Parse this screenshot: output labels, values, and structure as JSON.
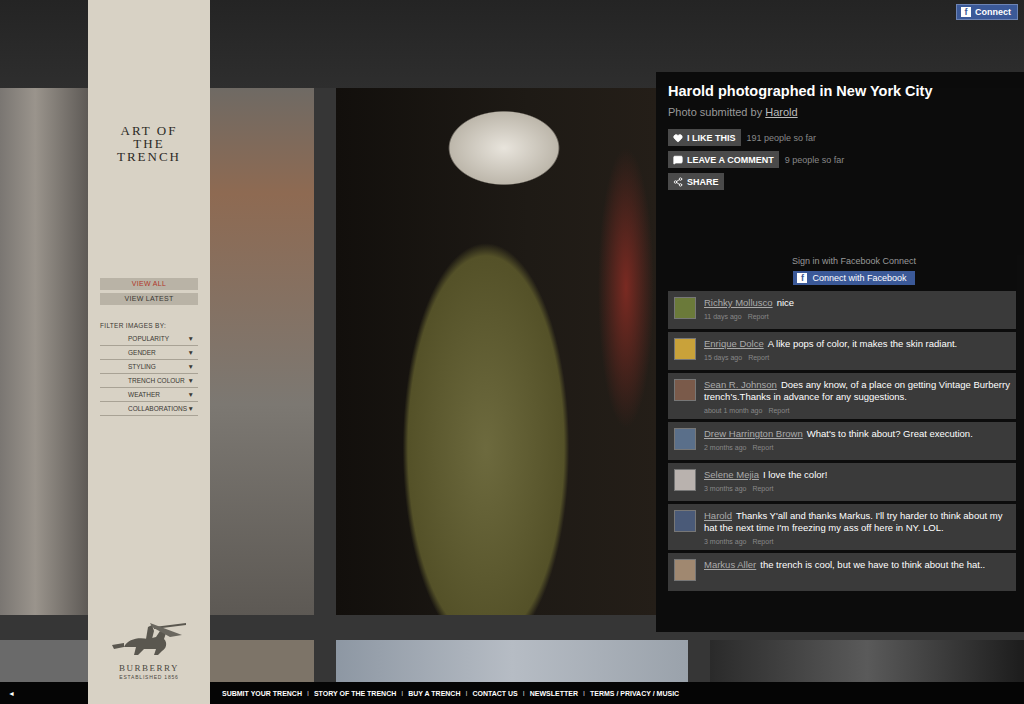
{
  "facebook_connect": {
    "icon": "f",
    "label": "Connect"
  },
  "sidebar": {
    "logo_lines": [
      "ART OF",
      "THE",
      "TRENCH"
    ],
    "nav": [
      {
        "label": "VIEW ALL",
        "selected": true
      },
      {
        "label": "VIEW LATEST",
        "selected": false
      }
    ],
    "filter_heading": "FILTER IMAGES BY:",
    "filters": [
      {
        "label": "POPULARITY",
        "arrow": "▼"
      },
      {
        "label": "GENDER",
        "arrow": "▼"
      },
      {
        "label": "STYLING",
        "arrow": "▼"
      },
      {
        "label": "TRENCH COLOUR",
        "arrow": "▼"
      },
      {
        "label": "WEATHER",
        "arrow": "▼"
      },
      {
        "label": "COLLABORATIONS",
        "arrow": "▼"
      }
    ],
    "brand": "BURBERRY",
    "brand_sub": "ESTABLISHED 1856"
  },
  "detail": {
    "title": "Harold photographed in New York City",
    "submitted_label": "Photo submitted by",
    "submitter": "Harold",
    "actions": [
      {
        "kind": "like",
        "label": "I LIKE THIS",
        "count": "191 people so far"
      },
      {
        "kind": "comment",
        "label": "LEAVE A COMMENT",
        "count": "9 people so far"
      },
      {
        "kind": "share",
        "label": "SHARE",
        "count": ""
      }
    ],
    "signin": "Sign in with Facebook Connect",
    "facebook_button": {
      "icon": "f",
      "label": "Connect with Facebook"
    },
    "report_label": "Report",
    "comments": [
      {
        "name": "Richky Mollusco",
        "text": "nice",
        "time": "11 days ago",
        "color": "#6b7a3a"
      },
      {
        "name": "Enrique Dolce",
        "text": "A like pops of color, it makes the skin radiant.",
        "time": "15 days ago",
        "color": "#c9a23a"
      },
      {
        "name": "Sean R. Johnson",
        "text": "Does any know, of a place on getting Vintage Burberry trench's.Thanks in advance for any suggestions.",
        "time": "about 1 month ago",
        "color": "#7a5a4a"
      },
      {
        "name": "Drew Harrington Brown",
        "text": "What's to think about? Great execution.",
        "time": "2 months ago",
        "color": "#5a6f8a"
      },
      {
        "name": "Selene Mejia",
        "text": "I love the color!",
        "time": "3 months ago",
        "color": "#b9b2ae"
      },
      {
        "name": "Harold",
        "text": "Thanks Y'all and thanks Markus. I'll try harder to think about my hat the next time I'm freezing my ass off here in NY. LOL.",
        "time": "3 months ago",
        "color": "#4a5a78"
      },
      {
        "name": "Markus Aller",
        "text": "the trench is cool, but we have to think about the hat..",
        "time": "",
        "color": "#a08870"
      }
    ]
  },
  "footer": {
    "back": "◄",
    "separator": "I",
    "links": [
      "SUBMIT YOUR TRENCH",
      "STORY OF THE TRENCH",
      "BUY A TRENCH",
      "CONTACT US",
      "NEWSLETTER",
      "TERMS / PRIVACY / MUSIC"
    ]
  }
}
